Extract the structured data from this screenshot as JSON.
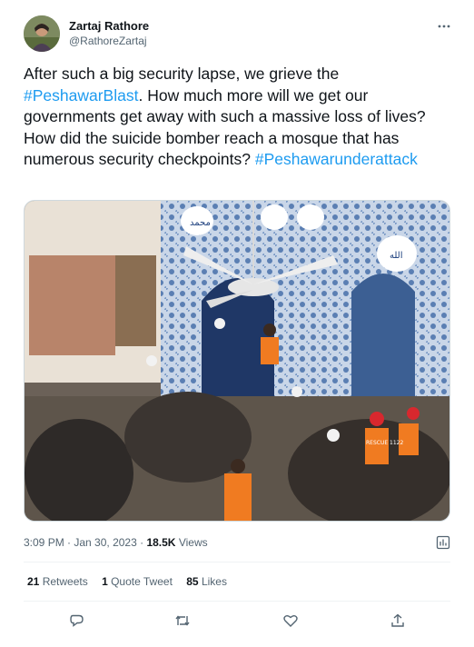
{
  "author": {
    "name": "Zartaj Rathore",
    "handle": "@RathoreZartaj"
  },
  "tweet": {
    "text_1": "After such a big security lapse, we grieve the ",
    "hashtag_1": "#PeshawarBlast",
    "text_2": ". How much more will we get our governments get away with such a massive loss of lives? How did the suicide bomber reach a mosque that has numerous security checkpoints? ",
    "hashtag_2": "#Peshawarunderattack"
  },
  "media": {
    "vest_text": "RESCUE 1122"
  },
  "meta": {
    "time": "3:09 PM",
    "separator_1": " · ",
    "date": "Jan 30, 2023",
    "separator_2": " · ",
    "views_count": "18.5K",
    "views_label": " Views"
  },
  "stats": {
    "retweets_count": "21",
    "retweets_label": " Retweets",
    "quotes_count": "1",
    "quotes_label": " Quote Tweet",
    "likes_count": "85",
    "likes_label": " Likes"
  },
  "icons": [
    "more-icon",
    "analytics-icon",
    "reply-icon",
    "retweet-icon",
    "like-icon",
    "share-icon"
  ],
  "colors": {
    "link": "#1d9bf0",
    "secondary": "#536471",
    "divider": "#eff3f4"
  }
}
